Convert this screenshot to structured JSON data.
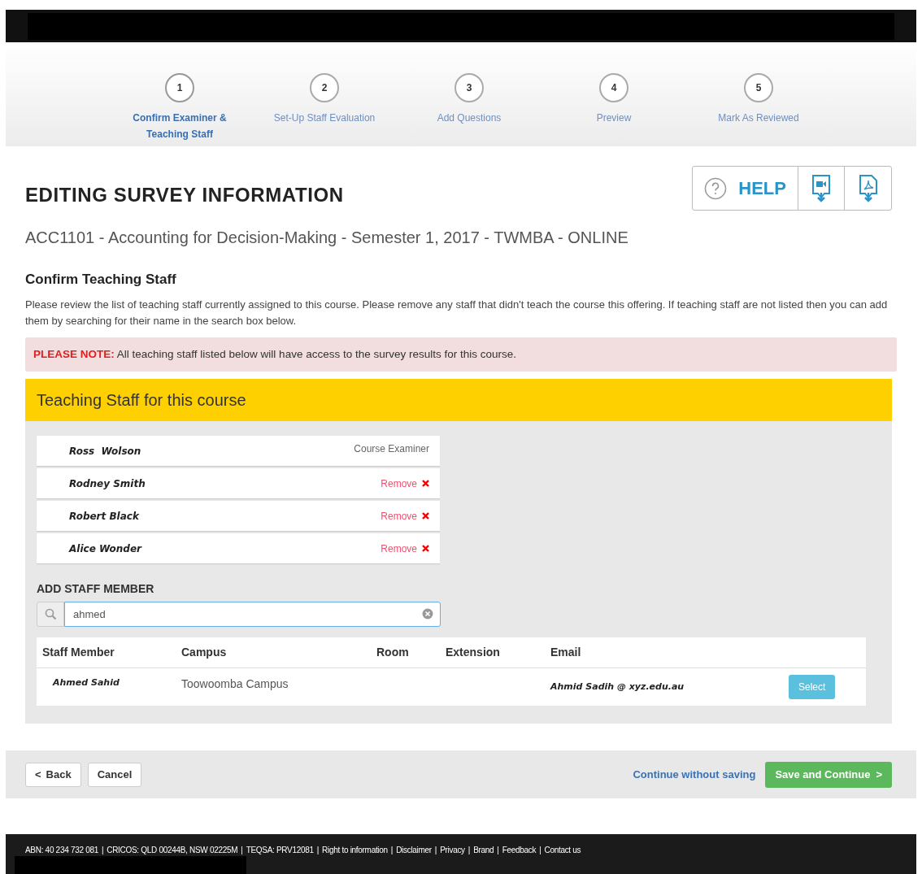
{
  "steps": [
    {
      "number": "1",
      "label": "Confirm Examiner & Teaching Staff",
      "selected": true
    },
    {
      "number": "2",
      "label": "Set-Up Staff Evaluation",
      "selected": false
    },
    {
      "number": "3",
      "label": "Add Questions",
      "selected": false
    },
    {
      "number": "4",
      "label": "Preview",
      "selected": false
    },
    {
      "number": "5",
      "label": "Mark As Reviewed",
      "selected": false
    }
  ],
  "page_title": "EDITING SURVEY INFORMATION",
  "help_button": "HELP",
  "course": "ACC1101 - Accounting for Decision-Making - Semester 1, 2017 - TWMBA - ONLINE",
  "section_title": "Confirm Teaching Staff",
  "instructions": "Please review the list of teaching staff currently assigned to this course. Please remove any staff that didn't teach the course this offering. If teaching staff are not listed then you can add them by searching for their name in the search box below.",
  "note": "**PLEASE NOTE:** All teaching staff listed below will have access to the survey results for this course.",
  "panel_title": "Teaching Staff for this course",
  "staff": [
    {
      "kind": "examiner",
      "name": "Ross  Wolson",
      "role": "Course Examiner"
    },
    {
      "kind": "removable",
      "name": "Rodney Smith",
      "action": "Remove"
    },
    {
      "kind": "removable",
      "name": "Robert Black",
      "action": "Remove"
    },
    {
      "kind": "removable",
      "name": "Alice Wonder",
      "action": "Remove"
    }
  ],
  "add_label": "ADD STAFF MEMBER",
  "search": {
    "value": "ahmed"
  },
  "results": {
    "columns": [
      "Staff Member",
      "Campus",
      "Room",
      "Extension",
      "Email"
    ],
    "rows": [
      {
        "name": "Ahmed Sahid",
        "campus": "Toowoomba Campus",
        "email": "Ahmid Sadih @ xyz.edu.au",
        "button": "Select"
      }
    ]
  },
  "footer_buttons": {
    "back": "Back",
    "back_icon": "<",
    "cancel": "Cancel",
    "continue_link": "Continue without saving",
    "save": "Save and Continue",
    "save_icon": ">"
  },
  "footer_separator": "|",
  "footer_links": [
    "ABN: 40 234 732 081",
    "CRICOS: QLD 00244B, NSW 02225M",
    "TEQSA: PRV12081",
    "Right to information",
    "Disclaimer",
    "Privacy",
    "Brand",
    "Feedback",
    "Contact us"
  ]
}
